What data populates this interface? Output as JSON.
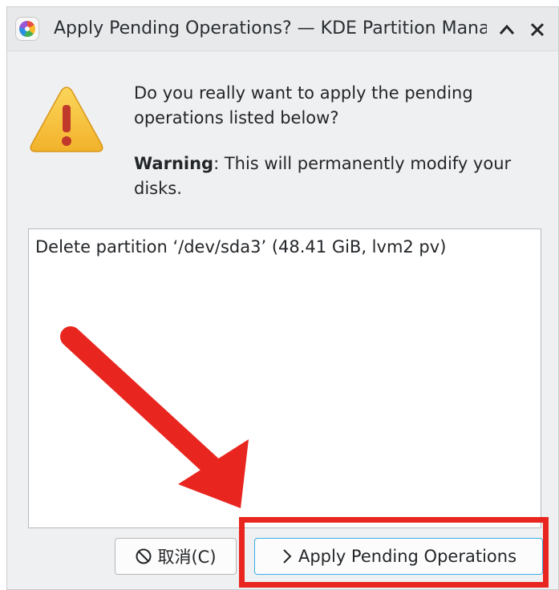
{
  "window": {
    "title": "Apply Pending Operations? — KDE Partition Manage",
    "up_glyph": "⌃",
    "close_glyph": "✕"
  },
  "dialog": {
    "question": "Do you really want to apply the pending operations listed below?",
    "warning_label": "Warning",
    "warning_message": ": This will permanently modify your disks."
  },
  "operations": [
    "Delete partition ‘/dev/sda3’ (48.41 GiB, lvm2 pv)"
  ],
  "buttons": {
    "cancel_label": "取消(C)",
    "apply_label": "Apply Pending Operations"
  },
  "icons": {
    "app": "partition-manager-icon",
    "warning": "warning-icon",
    "cancel": "cancel-icon",
    "apply": "chevron-right-icon"
  },
  "colors": {
    "annotation": "#e8261f",
    "focus": "#3daee9",
    "warning_fill": "#f7c23b"
  }
}
